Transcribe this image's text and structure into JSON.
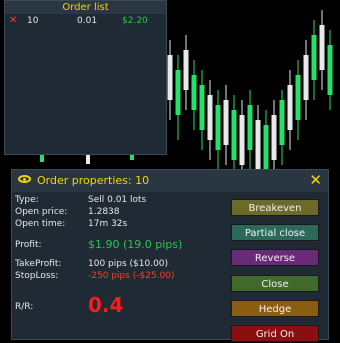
{
  "order_list": {
    "title": "Order list",
    "rows": [
      {
        "id": "10",
        "lots": "0.01",
        "profit": "$2.20"
      }
    ]
  },
  "order_props": {
    "title": "Order properties: 10",
    "type_label": "Type:",
    "type_value": "Sell  0.01 lots",
    "open_price_label": "Open price:",
    "open_price_value": "1.2838",
    "open_time_label": "Open time:",
    "open_time_value": "17m 32s",
    "profit_label": "Profit:",
    "profit_value": "$1.90 (19.0 pips)",
    "tp_label": "TakeProfit:",
    "tp_value": "100 pips ($10.00)",
    "sl_label": "StopLoss:",
    "sl_value": "-250 pips (-$25.00)",
    "rr_label": "R/R:",
    "rr_value": "0.4"
  },
  "buttons": {
    "breakeven": "Breakeven",
    "partial_close": "Partial close",
    "reverse": "Reverse",
    "close": "Close",
    "hedge": "Hedge",
    "grid_on": "Grid On"
  },
  "colors": {
    "accent": "#f2d600",
    "profit": "#26c74a",
    "loss": "#ff3b2f",
    "btn_breakeven": "#6b6a2a",
    "btn_partial": "#2b6a5a",
    "btn_reverse": "#6a2a7a",
    "btn_close": "#3f6a2c",
    "btn_hedge": "#8a5d10",
    "btn_grid": "#8a1010"
  }
}
